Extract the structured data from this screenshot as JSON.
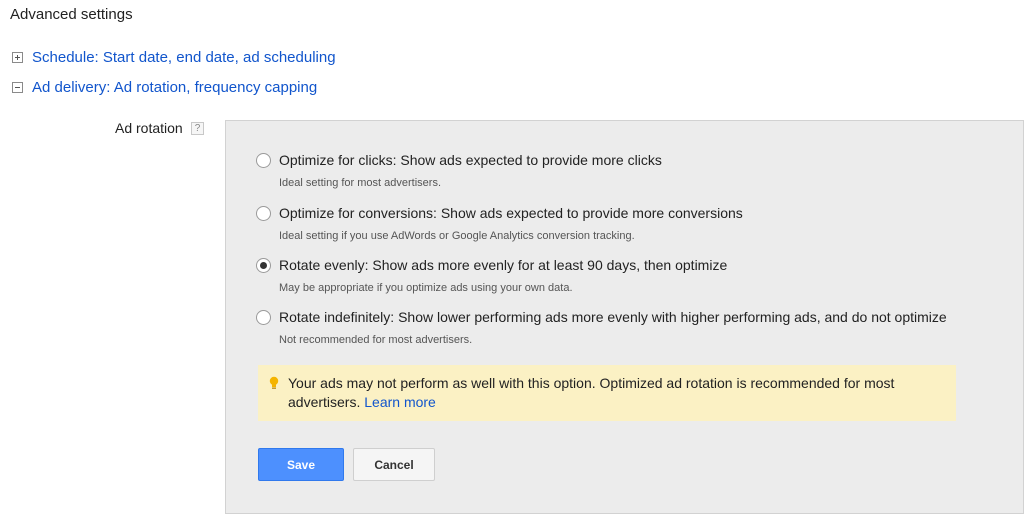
{
  "section_title": "Advanced settings",
  "expanders": {
    "schedule": {
      "label": "Schedule: Start date, end date, ad scheduling",
      "state": "collapsed"
    },
    "delivery": {
      "label": "Ad delivery: Ad rotation, frequency capping",
      "state": "expanded"
    }
  },
  "ad_rotation": {
    "label": "Ad rotation",
    "help_glyph": "?",
    "options": [
      {
        "label": "Optimize for clicks: Show ads expected to provide more clicks",
        "description": "Ideal setting for most advertisers.",
        "selected": false
      },
      {
        "label": "Optimize for conversions: Show ads expected to provide more conversions",
        "description": "Ideal setting if you use AdWords or Google Analytics conversion tracking.",
        "selected": false
      },
      {
        "label": "Rotate evenly: Show ads more evenly for at least 90 days, then optimize",
        "description": "May be appropriate if you optimize ads using your own data.",
        "selected": true
      },
      {
        "label": "Rotate indefinitely: Show lower performing ads more evenly with higher performing ads, and do not optimize",
        "description": "Not recommended for most advertisers.",
        "selected": false
      }
    ],
    "warning": {
      "text": "Your ads may not perform as well with this option. Optimized ad rotation is recommended for most advertisers.",
      "link": "Learn more",
      "icon": "lightbulb-icon"
    },
    "buttons": {
      "save": "Save",
      "cancel": "Cancel"
    }
  },
  "colors": {
    "link": "#1155cc",
    "save_button": "#4d90fe",
    "warning_bg": "#fbf1c4",
    "panel_bg": "#ececec",
    "bulb": "#f4b400"
  }
}
